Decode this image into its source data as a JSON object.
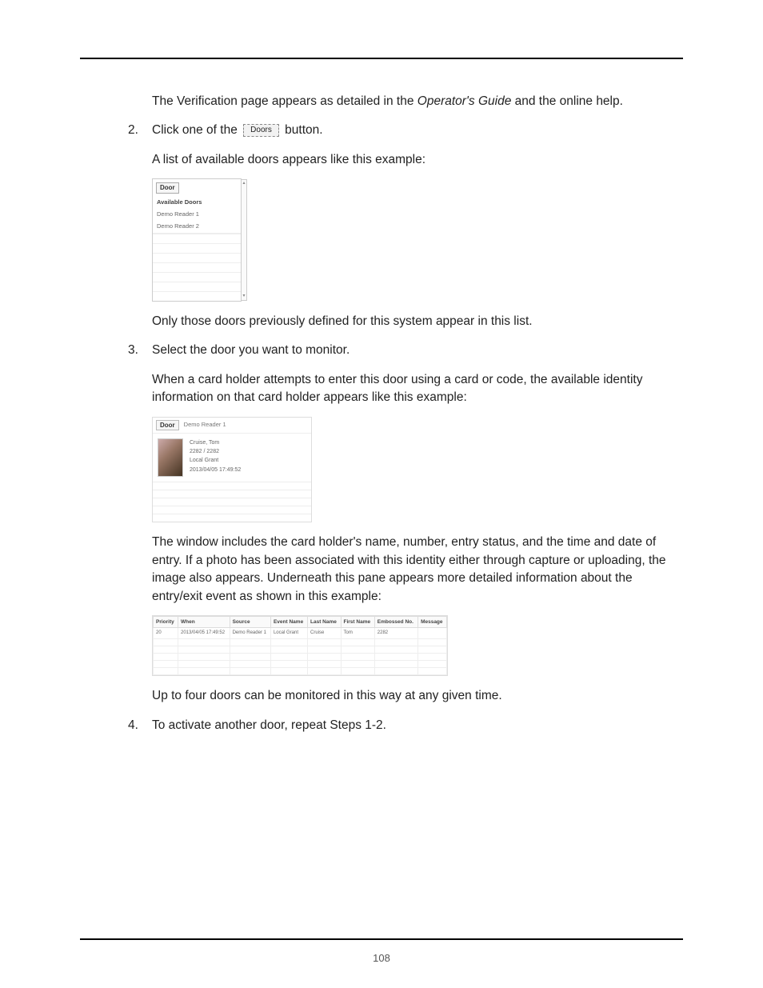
{
  "intro": "The Verification page appears as detailed in the Operator's Guide and the online help.",
  "step2": {
    "num": "2.",
    "line_a": "Click one of the ",
    "btn": "Doors",
    "line_b": " button.",
    "after": "A list of available doors appears like this example:"
  },
  "fig1": {
    "door_btn": "Door",
    "header": "Available Doors",
    "items": [
      "Demo Reader 1",
      "Demo Reader 2"
    ]
  },
  "only_doors": "Only those doors previously defined for this system appear in this list.",
  "step3": {
    "num": "3.",
    "text": "Select the door you want to monitor.",
    "after": "When a card holder attempts to enter this door using a card or code, the available identity information on that card holder appears like this example:"
  },
  "fig2": {
    "door_btn": "Door",
    "reader": "Demo Reader 1",
    "name": "Cruise, Tom",
    "card": "2282 / 2282",
    "status": "Local Grant",
    "time": "2013/04/05 17:49:52"
  },
  "window_includes": "The window includes the card holder's name, number, entry status, and the time and date of entry. If a photo has been associated with this identity either through capture or uploading,  the image also appears. Underneath this pane appears more detailed information about the entry/exit event as shown in this example:",
  "fig3": {
    "headers": [
      "Priority",
      "When",
      "Source",
      "Event Name",
      "Last Name",
      "First Name",
      "Embossed No.",
      "Message"
    ],
    "row": [
      "20",
      "2013/04/05 17:49:52",
      "Demo Reader 1",
      "Local Grant",
      "Cruise",
      "Tom",
      "2282",
      ""
    ]
  },
  "up_to_four": "Up to four doors can be monitored in this way at any given time.",
  "step4": {
    "num": "4.",
    "text": "To activate another door, repeat Steps 1-2."
  },
  "page_number": "108"
}
